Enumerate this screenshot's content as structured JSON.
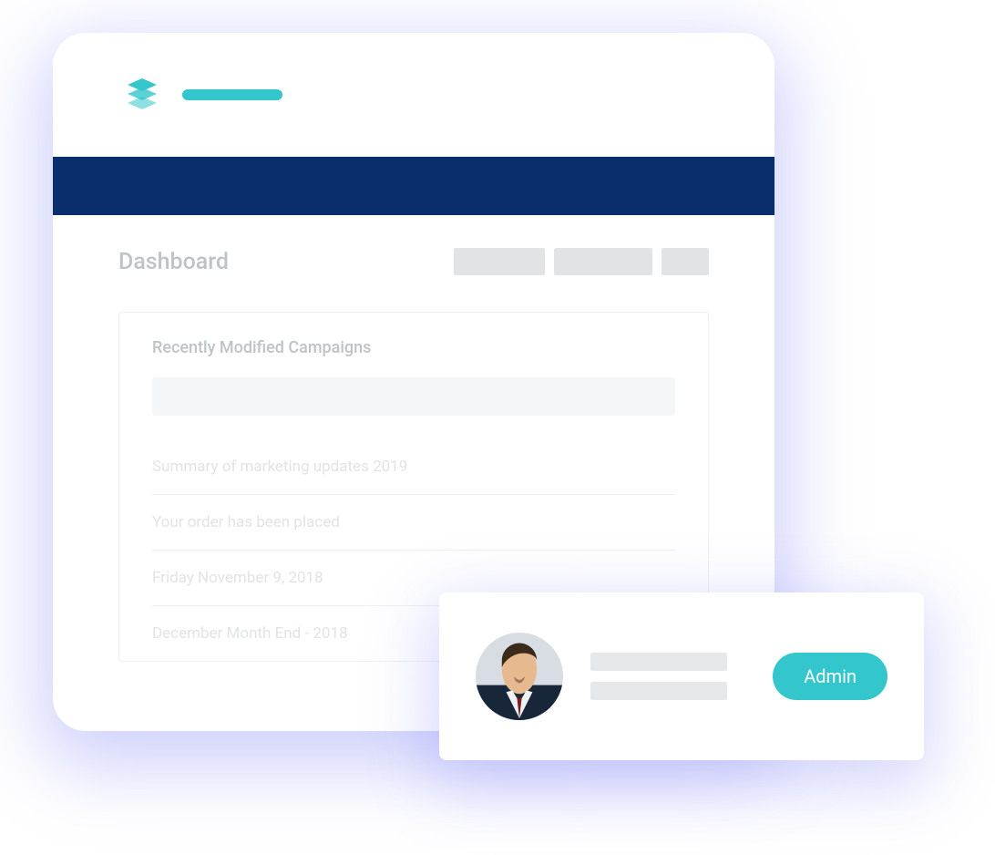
{
  "colors": {
    "accent": "#33c6cc",
    "nav": "#0a2e6c"
  },
  "page": {
    "title": "Dashboard",
    "panel": {
      "title": "Recently Modified Campaigns",
      "items": [
        "Summary of marketing updates 2019",
        "Your order has been placed",
        "Friday November 9, 2018",
        "December Month End - 2018"
      ]
    }
  },
  "user": {
    "role_badge": "Admin"
  }
}
